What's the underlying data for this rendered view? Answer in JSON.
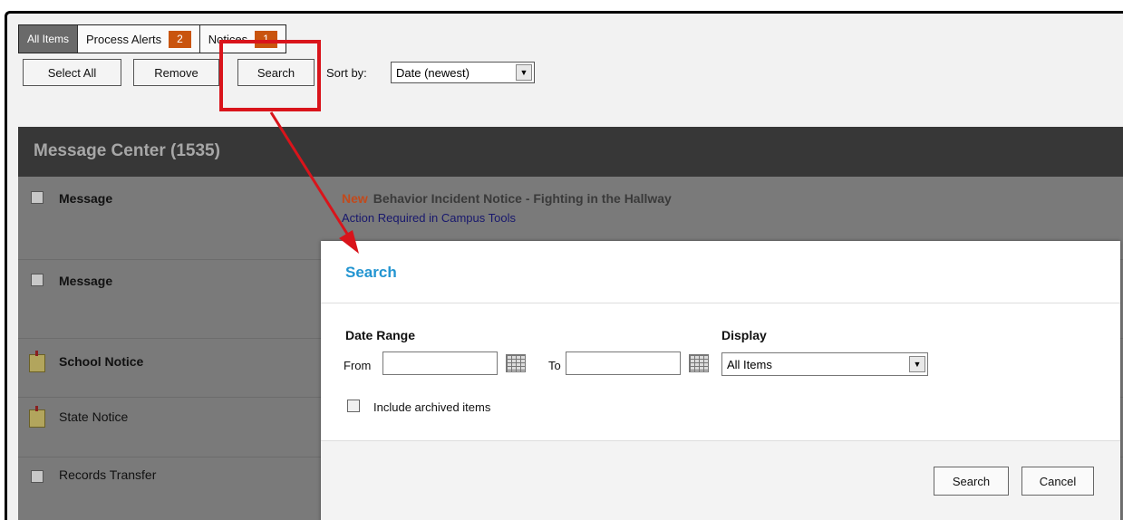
{
  "tabs": {
    "all_items": "All Items",
    "process_alerts": "Process Alerts",
    "process_alerts_count": "2",
    "notices": "Notices",
    "notices_count": "1"
  },
  "toolbar": {
    "select_all": "Select All",
    "remove": "Remove",
    "search": "Search",
    "sort_label": "Sort by:",
    "sort_value": "Date (newest)"
  },
  "message_center": {
    "title": "Message Center (1535)",
    "rows": [
      {
        "label": "Message",
        "type": "checkbox",
        "bold": true
      },
      {
        "label": "Message",
        "type": "checkbox",
        "bold": true
      },
      {
        "label": "School Notice",
        "type": "note",
        "bold": true
      },
      {
        "label": "State Notice",
        "type": "note",
        "bold": false
      },
      {
        "label": "Records Transfer",
        "type": "checkbox",
        "bold": false
      }
    ],
    "first_item": {
      "new_tag": "New",
      "subject": "Behavior Incident Notice - Fighting in the Hallway",
      "action": "Action Required in Campus Tools"
    }
  },
  "search_dialog": {
    "title": "Search",
    "date_range_label": "Date Range",
    "from_label": "From",
    "to_label": "To",
    "display_label": "Display",
    "display_value": "All Items",
    "include_archived": "Include archived items",
    "search_button": "Search",
    "cancel_button": "Cancel"
  },
  "colors": {
    "badge": "#c9540e",
    "highlight": "#d9141b",
    "dialog_title": "#2395d1"
  }
}
